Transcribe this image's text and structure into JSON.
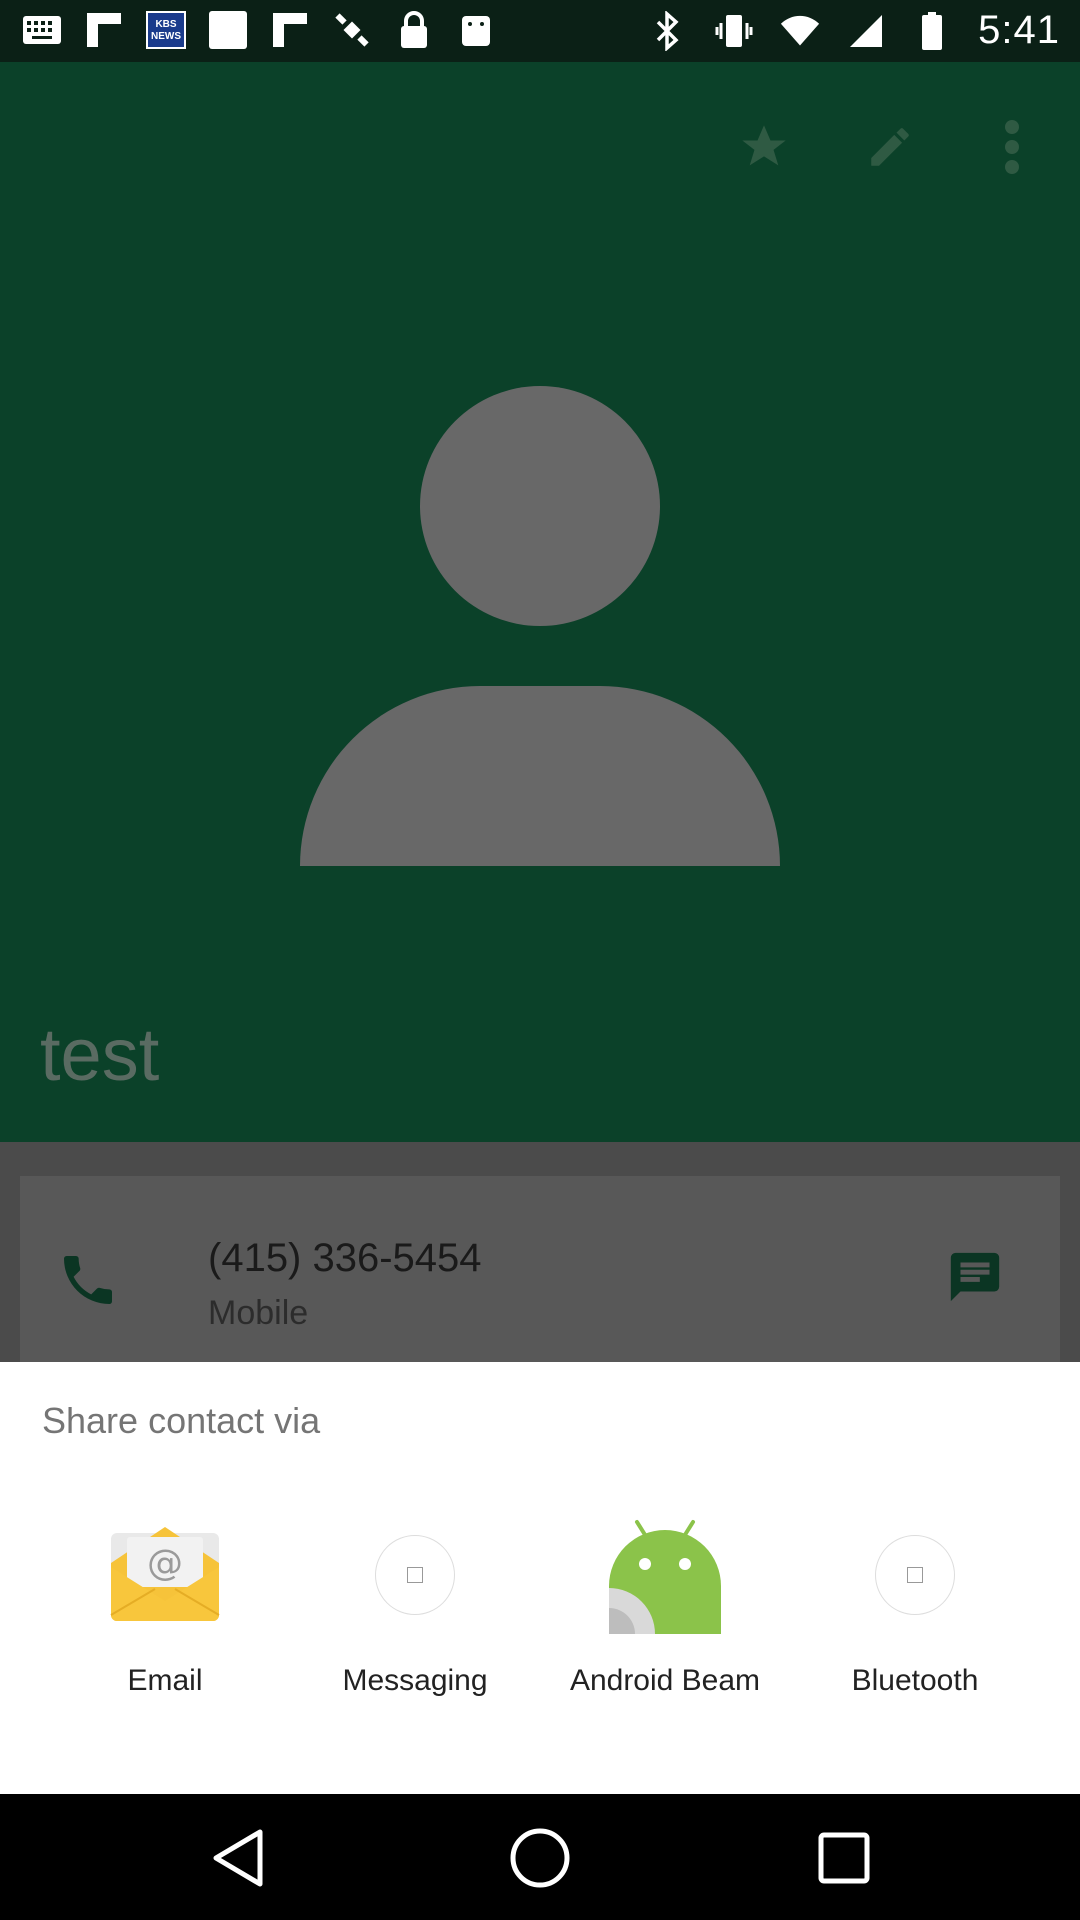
{
  "status_bar": {
    "time": "5:41",
    "kbs_badge": "KBS NEWS",
    "left_icons": [
      "keyboard-icon",
      "flipboard-icon",
      "kbs-news-icon",
      "blank-app-icon",
      "flipboard-icon",
      "gps-icon",
      "lock-icon",
      "android-icon"
    ],
    "right_icons": [
      "bluetooth-icon",
      "vibrate-icon",
      "wifi-icon",
      "signal-icon",
      "battery-icon"
    ]
  },
  "contact": {
    "name": "test",
    "phone_number": "(415) 336-5454",
    "phone_type": "Mobile"
  },
  "header_actions": [
    "star-icon",
    "edit-icon",
    "more-vert-icon"
  ],
  "share_sheet": {
    "title": "Share contact via",
    "targets": [
      {
        "label": "Email",
        "icon": "email-app-icon"
      },
      {
        "label": "Messaging",
        "icon": "messaging-app-icon"
      },
      {
        "label": "Android Beam",
        "icon": "android-beam-icon"
      },
      {
        "label": "Bluetooth",
        "icon": "bluetooth-app-icon"
      }
    ]
  },
  "colors": {
    "header_bg": "#0b4129",
    "avatar": "#686868",
    "dim_overlay": "#4b4b4b",
    "android_green": "#8bc34a",
    "email_yellow": "#f6c33a"
  },
  "nav_bar": [
    "back-icon",
    "home-icon",
    "recents-icon"
  ]
}
